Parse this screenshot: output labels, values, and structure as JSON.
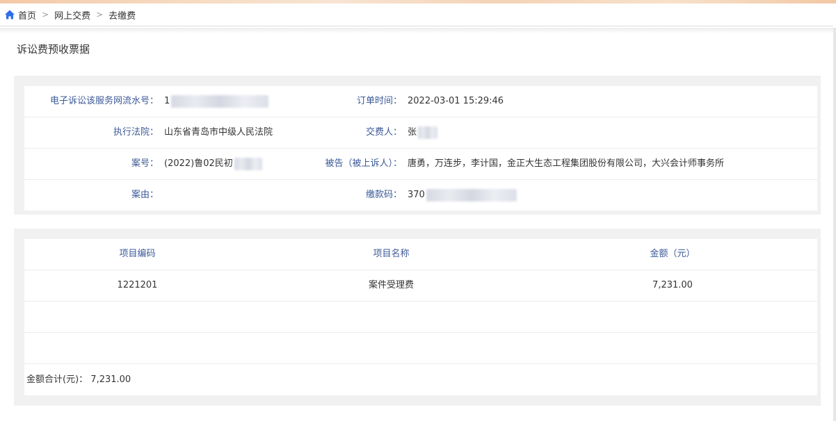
{
  "breadcrumb": {
    "home_icon": "home-icon",
    "items": [
      "首页",
      "网上交费",
      "去缴费"
    ]
  },
  "page_title": "诉讼费预收票据",
  "info": {
    "serial_label": "电子诉讼该服务网流水号：",
    "serial_value": "1",
    "order_time_label": "订单时间：",
    "order_time_value": "2022-03-01 15:29:46",
    "court_label": "执行法院：",
    "court_value": "山东省青岛市中级人民法院",
    "payer_label": "交费人：",
    "payer_value": "张",
    "case_no_label": "案号：",
    "case_no_value": "(2022)鲁02民初",
    "defendant_label": "被告（被上诉人）：",
    "defendant_value": "唐勇，万连步，李计国，金正大生态工程集团股份有限公司，大兴会计师事务所",
    "cause_label": "案由：",
    "cause_value": "",
    "pay_code_label": "缴款码：",
    "pay_code_value": "370"
  },
  "fees": {
    "headers": [
      "项目编码",
      "项目名称",
      "金额（元）"
    ],
    "rows": [
      {
        "code": "1221201",
        "name": "案件受理费",
        "amount": "7,231.00"
      }
    ],
    "total_label": "金额合计(元)：",
    "total_value": "7,231.00"
  },
  "colors": {
    "label_blue": "#3b5998",
    "home_icon_blue": "#2f6ee6",
    "panel_bg": "#f1f1f1"
  }
}
